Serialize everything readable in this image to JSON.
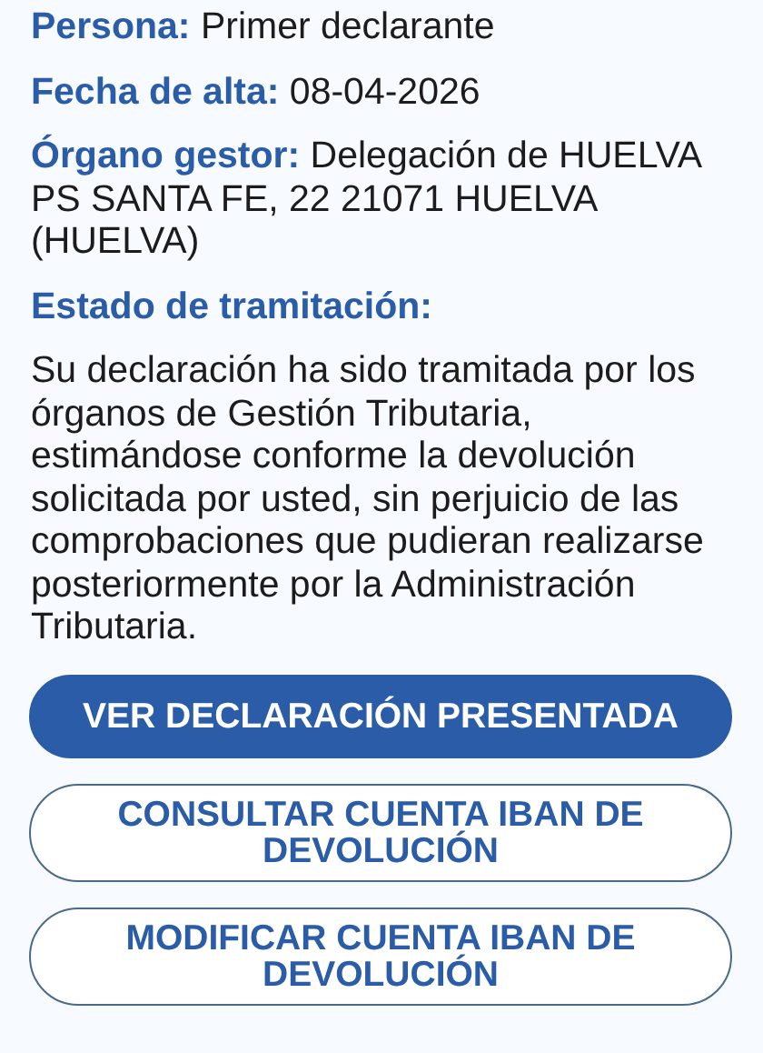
{
  "fields": [
    {
      "label": "Persona:",
      "value": "Primer declarante"
    },
    {
      "label": "Fecha de alta:",
      "value": "08-04-2026"
    },
    {
      "label": "Órgano gestor:",
      "value": "Delegación de HUELVA PS SANTA FE, 22 21071 HUELVA (HUELVA)"
    }
  ],
  "status": {
    "label": "Estado de tramitación:",
    "text": "Su declaración ha sido tramitada por los órganos de Gestión Tributaria, estimándose conforme la devolución solicitada por usted, sin perjuicio de las comprobaciones que pudieran realizarse posteriormente por la Administración Tributaria."
  },
  "buttons": [
    {
      "label": "VER DECLARACIÓN PRESENTADA",
      "kind": "primary"
    },
    {
      "label": "CONSULTAR CUENTA IBAN DE DEVOLUCIÓN",
      "kind": "outline"
    },
    {
      "label": "MODIFICAR CUENTA IBAN DE DEVOLUCIÓN",
      "kind": "outline"
    }
  ]
}
